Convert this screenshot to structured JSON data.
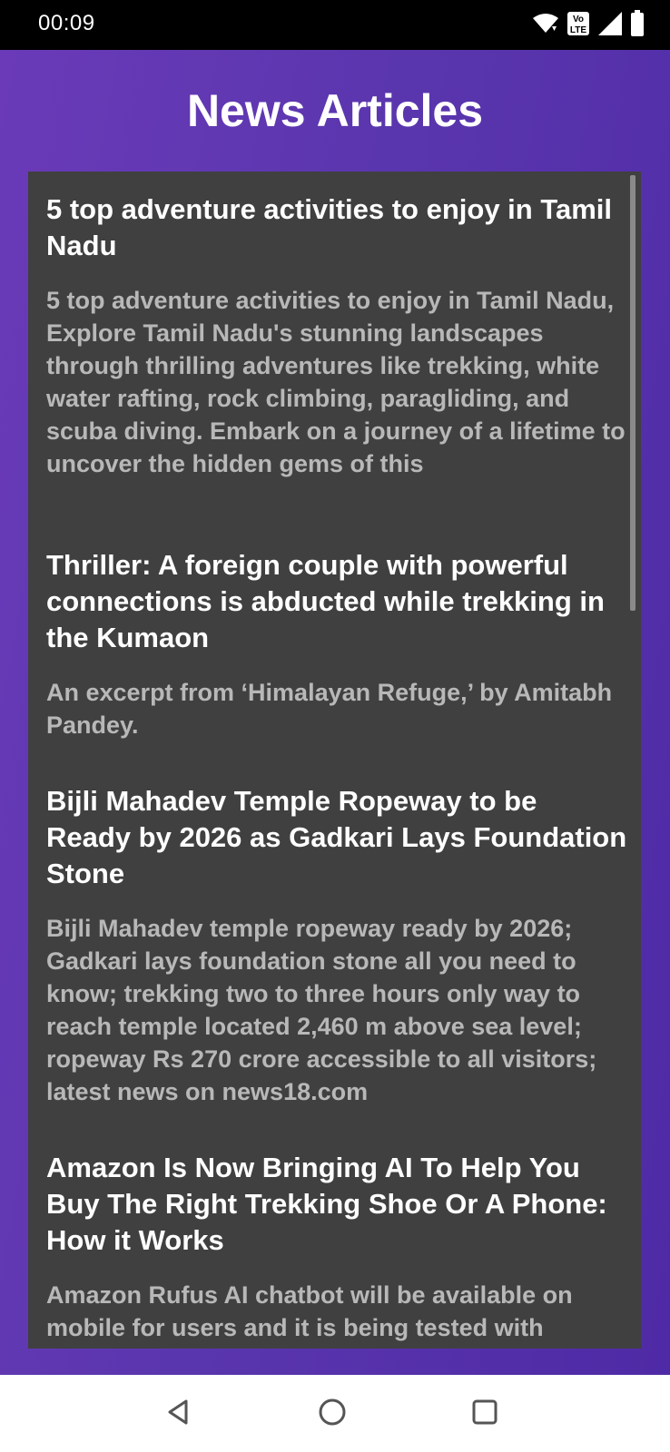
{
  "status_bar": {
    "time": "00:09",
    "icons": [
      "wifi-icon",
      "volte-icon",
      "signal-icon",
      "battery-icon"
    ],
    "volte_text": "Vo LTE"
  },
  "header": {
    "title": "News Articles"
  },
  "articles": [
    {
      "title": "5 top adventure activities to enjoy in Tamil Nadu",
      "description": "5 top adventure activities to enjoy in Tamil Nadu, Explore Tamil Nadu's stunning landscapes through thrilling adventures like trekking, white water rafting, rock climbing, paragliding, and scuba diving. Embark on a journey of a lifetime to uncover the hidden gems of this"
    },
    {
      "title": "Thriller: A foreign couple with powerful connections is abducted while trekking in the Kumaon",
      "description": "An excerpt from ‘Himalayan Refuge,’ by Amitabh Pandey."
    },
    {
      "title": "Bijli Mahadev Temple Ropeway to be Ready by 2026 as Gadkari Lays Foundation Stone",
      "description": "Bijli Mahadev temple ropeway ready by 2026; Gadkari lays foundation stone all you need to know; trekking two to three hours only way to reach temple located 2,460 m above sea level; ropeway Rs 270 crore accessible to all visitors; latest news on news18.com"
    },
    {
      "title": "Amazon Is Now Bringing AI To Help You Buy The Right Trekking Shoe Or A Phone: How it Works",
      "description": "Amazon Rufus AI chatbot will be available on mobile for users and it is being tested with"
    }
  ],
  "nav_bar": {
    "icons": [
      "back-icon",
      "home-icon",
      "recents-icon"
    ]
  },
  "colors": {
    "background_gradient_start": "#6a3ab8",
    "background_gradient_end": "#4f2aa6",
    "panel": "#404040",
    "title_text": "#ffffff",
    "description_text": "#b8b8b8"
  }
}
